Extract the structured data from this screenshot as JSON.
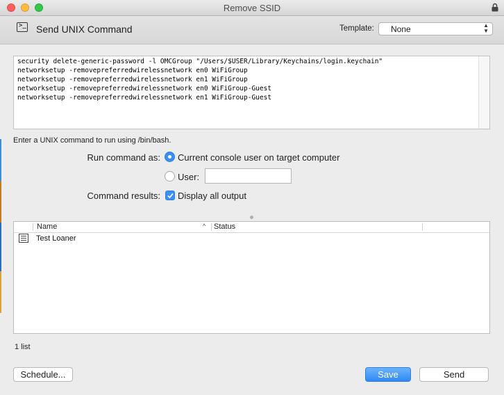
{
  "window": {
    "title": "Remove SSID"
  },
  "header": {
    "title": "Send UNIX Command",
    "template_label": "Template:",
    "template_value": "None"
  },
  "command": {
    "lines": [
      "security delete-generic-password -l OMCGroup \"/Users/$USER/Library/Keychains/login.keychain\"",
      "networksetup -removepreferredwirelessnetwork en0 WiFiGroup",
      "networksetup -removepreferredwirelessnetwork en1 WiFiGroup",
      "networksetup -removepreferredwirelessnetwork en0 WiFiGroup-Guest",
      "networksetup -removepreferredwirelessnetwork en1 WiFiGroup-Guest"
    ],
    "hint": "Enter a UNIX command to run using /bin/bash."
  },
  "options": {
    "run_as_label": "Run command as:",
    "console_user_label": "Current console user on target computer",
    "user_label": "User:",
    "user_value": "",
    "results_label": "Command results:",
    "display_output_label": "Display all output"
  },
  "table": {
    "columns": [
      "Name",
      "Status"
    ],
    "rows": [
      {
        "name": "Test Loaner",
        "status": ""
      }
    ],
    "count_label": "1 list"
  },
  "buttons": {
    "schedule": "Schedule...",
    "save": "Save",
    "send": "Send"
  },
  "colors": {
    "accent": "#3a8ff2",
    "window_bg": "#ececec"
  }
}
